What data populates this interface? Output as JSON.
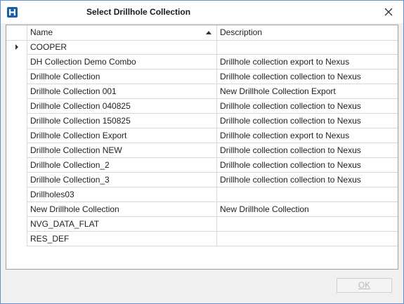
{
  "window": {
    "title": "Select Drillhole Collection"
  },
  "grid": {
    "columns": [
      {
        "label": "Name",
        "sorted": "ascending"
      },
      {
        "label": "Description"
      }
    ],
    "rows": [
      {
        "name": "COOPER",
        "description": ""
      },
      {
        "name": "DH Collection Demo Combo",
        "description": "Drillhole collection export to Nexus"
      },
      {
        "name": "Drillhole Collection",
        "description": "Drillhole collection collection to Nexus"
      },
      {
        "name": "Drillhole Collection 001",
        "description": "New Drillhole Collection Export"
      },
      {
        "name": "Drillhole Collection 040825",
        "description": "Drillhole collection collection to Nexus"
      },
      {
        "name": "Drillhole Collection 150825",
        "description": "Drillhole collection collection to Nexus"
      },
      {
        "name": "Drillhole Collection Export",
        "description": "Drillhole collection export to Nexus"
      },
      {
        "name": "Drillhole Collection NEW",
        "description": "Drillhole collection collection to Nexus"
      },
      {
        "name": "Drillhole Collection_2",
        "description": "Drillhole collection collection to Nexus"
      },
      {
        "name": "Drillhole Collection_3",
        "description": "Drillhole collection collection to Nexus"
      },
      {
        "name": "Drillholes03",
        "description": ""
      },
      {
        "name": "New Drillhole Collection",
        "description": "New Drillhole Collection"
      },
      {
        "name": "NVG_DATA_FLAT",
        "description": ""
      },
      {
        "name": "RES_DEF",
        "description": ""
      }
    ]
  },
  "footer": {
    "ok_label": "OK",
    "ok_enabled": false
  },
  "icons": {
    "app": "app-logo-icon",
    "close": "close-icon",
    "sort": "sort-ascending-icon",
    "row_indicator": "current-row-indicator-icon"
  },
  "colors": {
    "app_icon_bg": "#1b5fa8",
    "window_border": "#6f8fc9",
    "grid_line": "#d8d8d8",
    "disabled_text": "#b8b8b8"
  }
}
